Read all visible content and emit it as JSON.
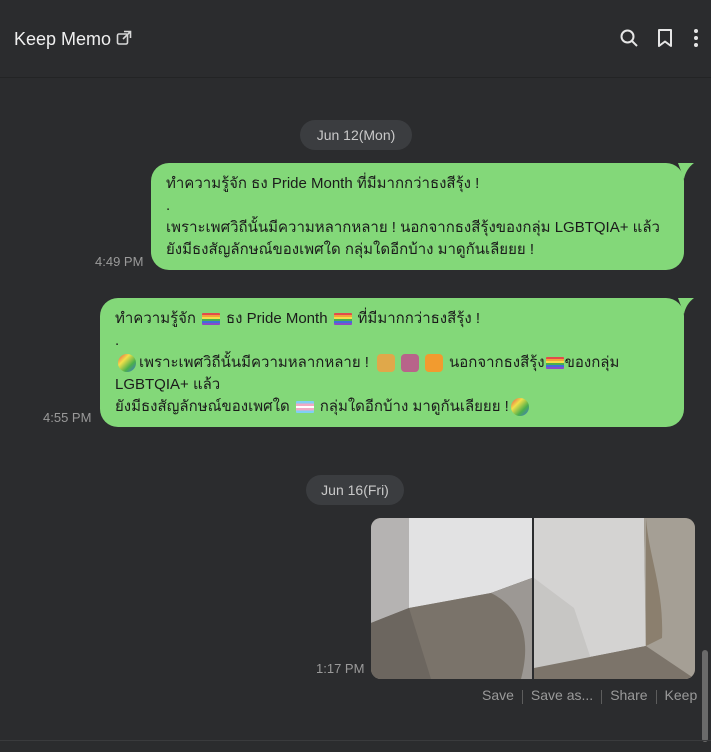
{
  "header": {
    "title": "Keep Memo",
    "icons": [
      "external-link-icon",
      "search-icon",
      "bookmark-icon",
      "more-vertical-icon"
    ]
  },
  "colors": {
    "background": "#2b2c2e",
    "bubble": "#83d879",
    "date_pill": "#3b3d40"
  },
  "dates": {
    "d1": "Jun 12(Mon)",
    "d2": "Jun 16(Fri)"
  },
  "messages": [
    {
      "time": "4:49 PM",
      "lines": [
        "ทำความรู้จัก ธง Pride Month ที่มีมากกว่าธงสีรุ้ง !",
        ".",
        "เพราะเพศวิถีนั้นมีความหลากหลาย ! นอกจากธงสีรุ้งของกลุ่ม LGBTQIA+ แล้ว",
        "ยังมีธงสัญลักษณ์ของเพศใด กลุ่มใดอีกบ้าง มาดูกันเลียยย !"
      ]
    },
    {
      "time": "4:55 PM",
      "l1a": "ทำความรู้จัก",
      "l1b": "ธง Pride Month",
      "l1c": "ที่มีมากกว่าธงสีรุ้ง !",
      "l2": ".",
      "l3a": "เพราะเพศวิถีนั้นมีความหลากหลาย !",
      "l3b": "นอกจากธงสีรุ้ง",
      "l3c": "ของกลุ่ม",
      "l4": "LGBTQIA+ แล้ว",
      "l5a": "ยังมีธงสัญลักษณ์ของเพศใด",
      "l5b": "กลุ่มใดอีกบ้าง มาดูกันเลียยย !"
    },
    {
      "time": "1:17 PM",
      "image": "two-photos-of-wall-corner"
    }
  ],
  "image_actions": [
    "Save",
    "Save as...",
    "Share",
    "Keep"
  ]
}
